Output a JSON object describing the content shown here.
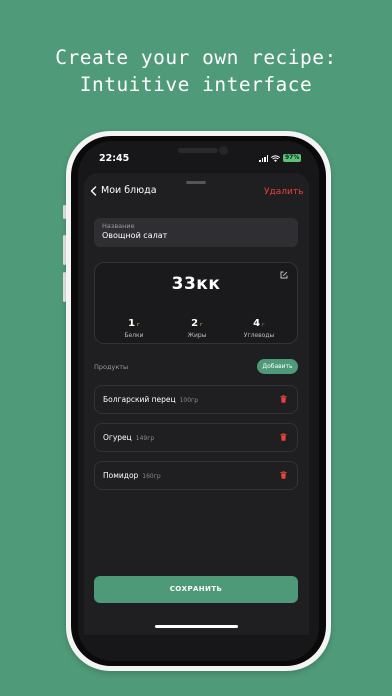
{
  "headline": {
    "line1": "Create your own recipe:",
    "line2": "Intuitive interface"
  },
  "status_bar": {
    "time": "22:45",
    "battery": "97%"
  },
  "nav": {
    "back_label": "Мои блюда",
    "delete_label": "Удалить"
  },
  "name_field": {
    "label": "Название",
    "value": "Овощной салат"
  },
  "nutrition": {
    "calories": "33кк",
    "macros": [
      {
        "value": "1",
        "unit": "г",
        "label": "Белки",
        "unit_color": "#e6c34a"
      },
      {
        "value": "2",
        "unit": "г",
        "label": "Жиры",
        "unit_color": "#e6a040"
      },
      {
        "value": "4",
        "unit": "г",
        "label": "Углеводы",
        "unit_color": "#8a6ad9"
      }
    ]
  },
  "products": {
    "section_label": "Продукты",
    "add_label": "Добавить",
    "items": [
      {
        "name": "Болгарский перец",
        "qty": "100гр"
      },
      {
        "name": "Огурец",
        "qty": "149гр"
      },
      {
        "name": "Помидор",
        "qty": "160гр"
      }
    ]
  },
  "save_label": "СОХРАНИТЬ",
  "colors": {
    "background": "#4f9a78",
    "accent": "#4e9a78",
    "danger": "#e5433c",
    "screen": "#17171a"
  },
  "icons": [
    "chevron-left-icon",
    "edit-icon",
    "trash-icon",
    "signal-icon",
    "wifi-icon",
    "battery-icon"
  ]
}
